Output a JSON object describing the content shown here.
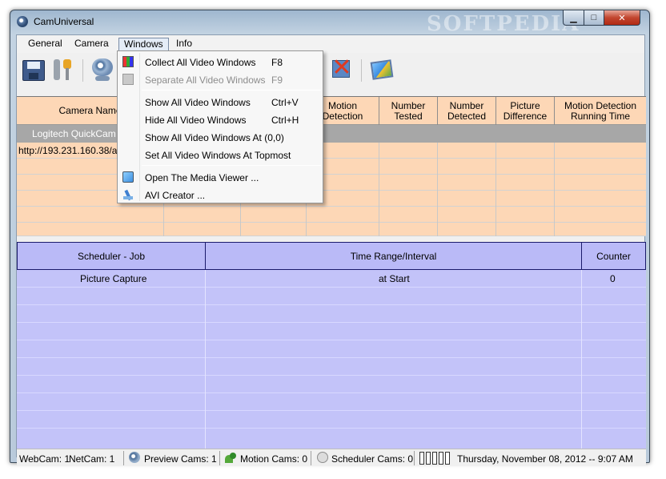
{
  "window": {
    "title": "CamUniversal",
    "watermark": "SOFTPEDIA",
    "min_glyph": "▁",
    "max_glyph": "□",
    "close_glyph": "✕"
  },
  "menubar": {
    "items": [
      "General",
      "Camera",
      "Windows",
      "Info"
    ]
  },
  "toolbar": {
    "stop_glyph": "✕"
  },
  "windows_menu": {
    "items": [
      {
        "label": "Collect All Video Windows",
        "shortcut": "F8",
        "enabled": true
      },
      {
        "label": "Separate All Video Windows",
        "shortcut": "F9",
        "enabled": false
      },
      {
        "label": "Show All Video Windows",
        "shortcut": "Ctrl+V",
        "enabled": true
      },
      {
        "label": "Hide All Video Windows",
        "shortcut": "Ctrl+H",
        "enabled": true
      },
      {
        "label": "Show All Video Windows At (0,0)",
        "shortcut": "",
        "enabled": true
      },
      {
        "label": "Set All Video Windows At Topmost",
        "shortcut": "",
        "enabled": true
      },
      {
        "label": "Open The Media Viewer ...",
        "shortcut": "",
        "enabled": true
      },
      {
        "label": "AVI Creator ...",
        "shortcut": "",
        "enabled": true
      }
    ]
  },
  "camera_table": {
    "headers": {
      "camera_name": "Camera Name",
      "motion_detection": "Motion Detection",
      "number_tested": "Number Tested",
      "number_detected": "Number Detected",
      "picture_difference": "Picture Difference",
      "motion_running_time": "Motion Detection Running Time"
    },
    "rows": [
      {
        "camera_name": "Logitech QuickCam F"
      },
      {
        "camera_name": "http://193.231.160.38/axi"
      }
    ]
  },
  "scheduler_table": {
    "headers": [
      "Scheduler - Job",
      "Time Range/Interval",
      "Counter"
    ],
    "rows": [
      {
        "job": "Picture Capture",
        "range": "at Start",
        "counter": "0"
      }
    ]
  },
  "statusbar": {
    "webcam": "WebCam: 1",
    "netcam": "NetCam: 1",
    "preview": "Preview Cams: 1",
    "motion": "Motion Cams: 0",
    "scheduler": "Scheduler Cams: 0",
    "datetime": "Thursday, November 08, 2012 -- 9:07 AM"
  }
}
